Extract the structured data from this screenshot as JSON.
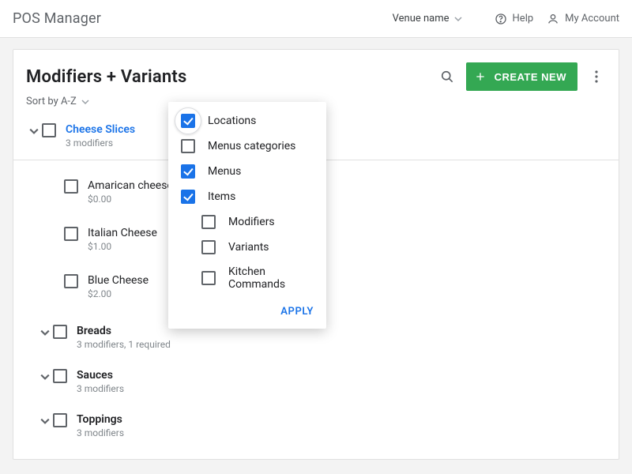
{
  "header": {
    "brand": "POS Manager",
    "venue_label": "Venue name",
    "help_label": "Help",
    "account_label": "My Account"
  },
  "page": {
    "title": "Modifiers + Variants",
    "sort_label": "Sort by A-Z",
    "create_label": "CREATE NEW"
  },
  "filter": {
    "items": [
      {
        "label": "Locations",
        "checked": true,
        "indent": false
      },
      {
        "label": "Menus categories",
        "checked": false,
        "indent": false
      },
      {
        "label": "Menus",
        "checked": true,
        "indent": false
      },
      {
        "label": "Items",
        "checked": true,
        "indent": false
      },
      {
        "label": "Modifiers",
        "checked": false,
        "indent": true
      },
      {
        "label": "Variants",
        "checked": false,
        "indent": true
      },
      {
        "label": "Kitchen Commands",
        "checked": false,
        "indent": true
      }
    ],
    "apply_label": "APPLY"
  },
  "tree": {
    "open_group": {
      "label": "Cheese Slices",
      "subtitle": "3 modifiers",
      "items": [
        {
          "label": "Amarican cheese",
          "price": "$0.00"
        },
        {
          "label": "Italian Cheese",
          "price": "$1.00"
        },
        {
          "label": "Blue Cheese",
          "price": "$2.00"
        }
      ]
    },
    "closed_groups": [
      {
        "label": "Breads",
        "subtitle": "3 modifiers, 1 required"
      },
      {
        "label": "Sauces",
        "subtitle": "3 modifiers"
      },
      {
        "label": "Toppings",
        "subtitle": "3 modifiers"
      }
    ]
  }
}
